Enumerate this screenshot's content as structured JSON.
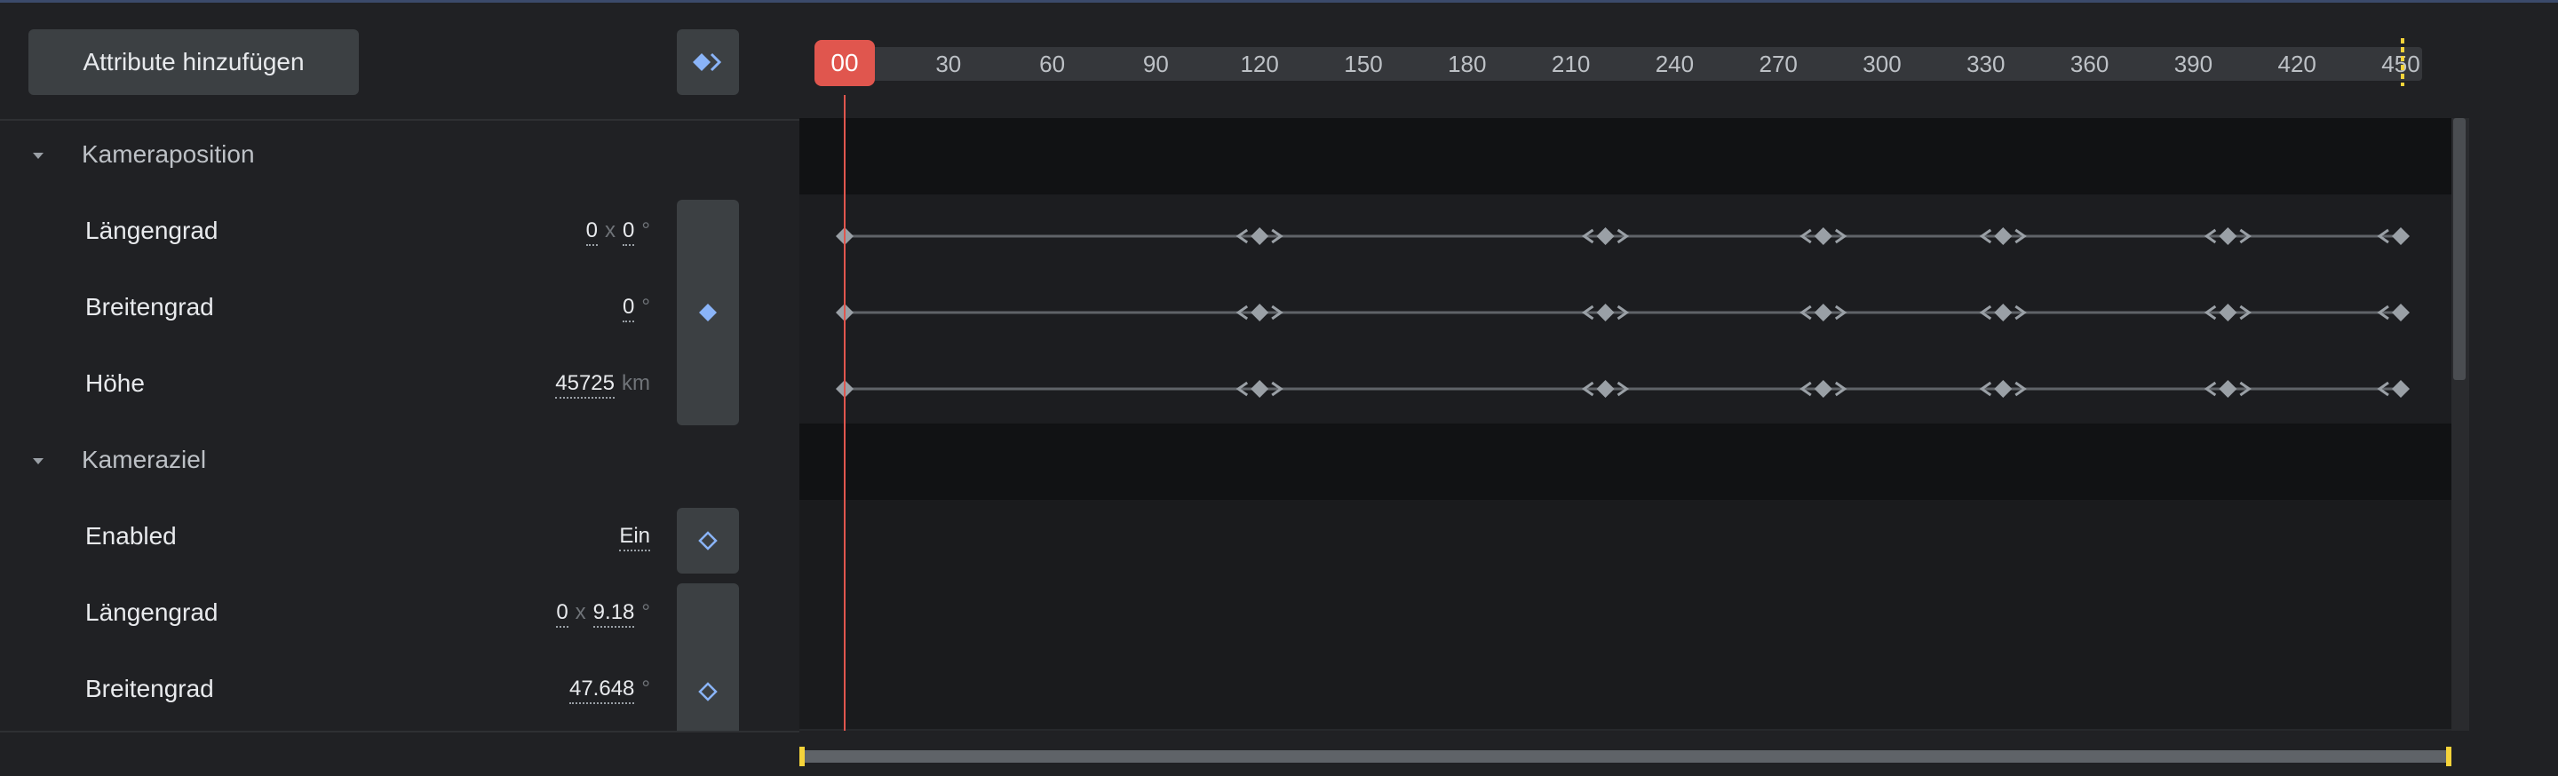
{
  "toolbar": {
    "add_attributes_label": "Attribute hinzufügen",
    "keyframe_nav_icon": "diamond-arrow-icon"
  },
  "sections": [
    {
      "title": "Kameraposition",
      "rows": [
        {
          "label": "Längengrad",
          "x": "0",
          "sep": "x",
          "y": "0",
          "unit": "°"
        },
        {
          "label": "Breitengrad",
          "value": "0",
          "unit": "°"
        },
        {
          "label": "Höhe",
          "value": "45725",
          "unit": "km"
        }
      ]
    },
    {
      "title": "Kameraziel",
      "rows": [
        {
          "label": "Enabled",
          "value": "Ein"
        },
        {
          "label": "Längengrad",
          "x": "0",
          "sep": "x",
          "y": "9.18",
          "unit": "°"
        },
        {
          "label": "Breitengrad",
          "value": "47.648",
          "unit": "°"
        }
      ]
    }
  ],
  "timeline": {
    "playhead_label": "00",
    "ticks": [
      "30",
      "60",
      "90",
      "120",
      "150",
      "180",
      "210",
      "240",
      "270",
      "300",
      "330",
      "360",
      "390",
      "420",
      "450"
    ],
    "keyframes": [
      0,
      120,
      220,
      283,
      335,
      400,
      450
    ],
    "colors": {
      "playhead": "#e0564e",
      "accent": "#8ab4f8",
      "end_marker": "#f5d33a"
    }
  }
}
